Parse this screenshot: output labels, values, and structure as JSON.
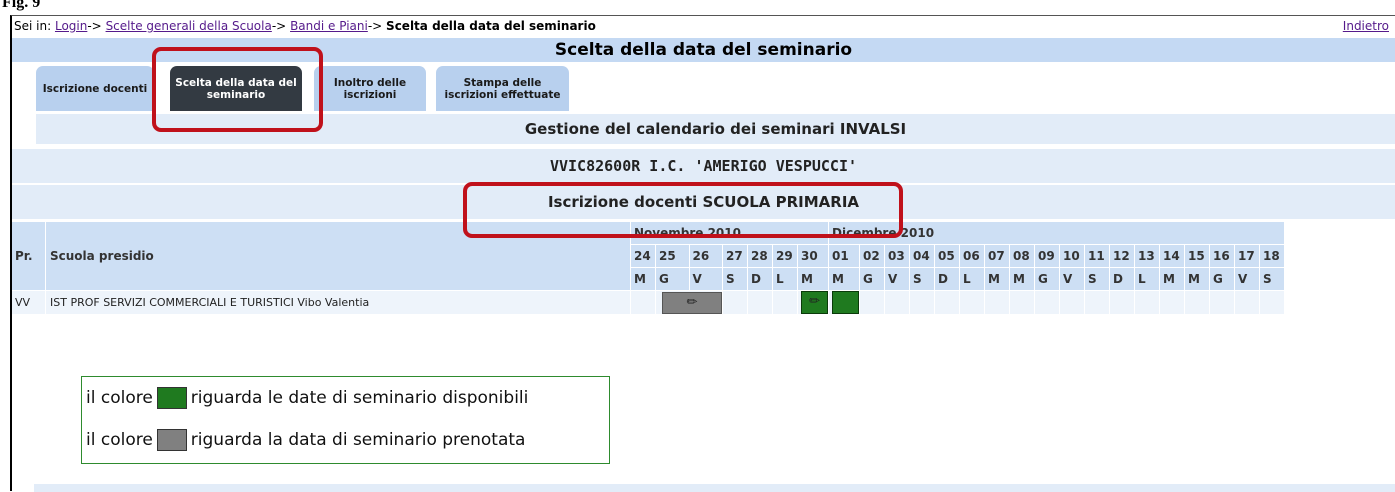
{
  "figure_label": "Fig. 9",
  "breadcrumb": {
    "prefix": "Sei in:",
    "items": [
      "Login",
      "Scelte generali della Scuola",
      "Bandi e Piani"
    ],
    "sep": "->",
    "current": "Scelta della data del seminario"
  },
  "back_label": "Indietro",
  "page_title": "Scelta della data del seminario",
  "tabs": [
    {
      "label": "Iscrizione docenti",
      "active": false
    },
    {
      "label": "Scelta della data del seminario",
      "active": true
    },
    {
      "label": "Inoltro delle iscrizioni",
      "active": false
    },
    {
      "label": "Stampa delle iscrizioni effettuate",
      "active": false
    }
  ],
  "section_title": "Gestione del calendario dei seminari INVALSI",
  "school_name": "VVIC82600R I.C. 'AMERIGO VESPUCCI'",
  "enrollment_title": "Iscrizione docenti SCUOLA PRIMARIA",
  "table": {
    "col_pr": "Pr.",
    "col_school": "Scuola presidio",
    "month1": "Novembre 2010",
    "month2": "Dicembre 2010",
    "days": [
      "24",
      "25",
      "26",
      "27",
      "28",
      "29",
      "30",
      "01",
      "02",
      "03",
      "04",
      "05",
      "06",
      "07",
      "08",
      "09",
      "10",
      "11",
      "12",
      "13",
      "14",
      "15",
      "16",
      "17",
      "18"
    ],
    "weekdays": [
      "M",
      "G",
      "V",
      "S",
      "D",
      "L",
      "M",
      "M",
      "G",
      "V",
      "S",
      "D",
      "L",
      "M",
      "M",
      "G",
      "V",
      "S",
      "D",
      "L",
      "M",
      "M",
      "G",
      "V",
      "S"
    ],
    "rows": [
      {
        "pr": "VV",
        "school": "IST PROF SERVIZI COMMERCIALI E TURISTICI Vibo Valentia"
      }
    ]
  },
  "legend": {
    "line1_prefix": "il colore",
    "line1_text": "riguarda le date di seminario disponibili",
    "line2_prefix": "il colore",
    "line2_text": "riguarda la data di seminario prenotata"
  },
  "colors": {
    "available": "#1f7a1f",
    "booked": "#808080",
    "highlight": "#c0111b"
  }
}
